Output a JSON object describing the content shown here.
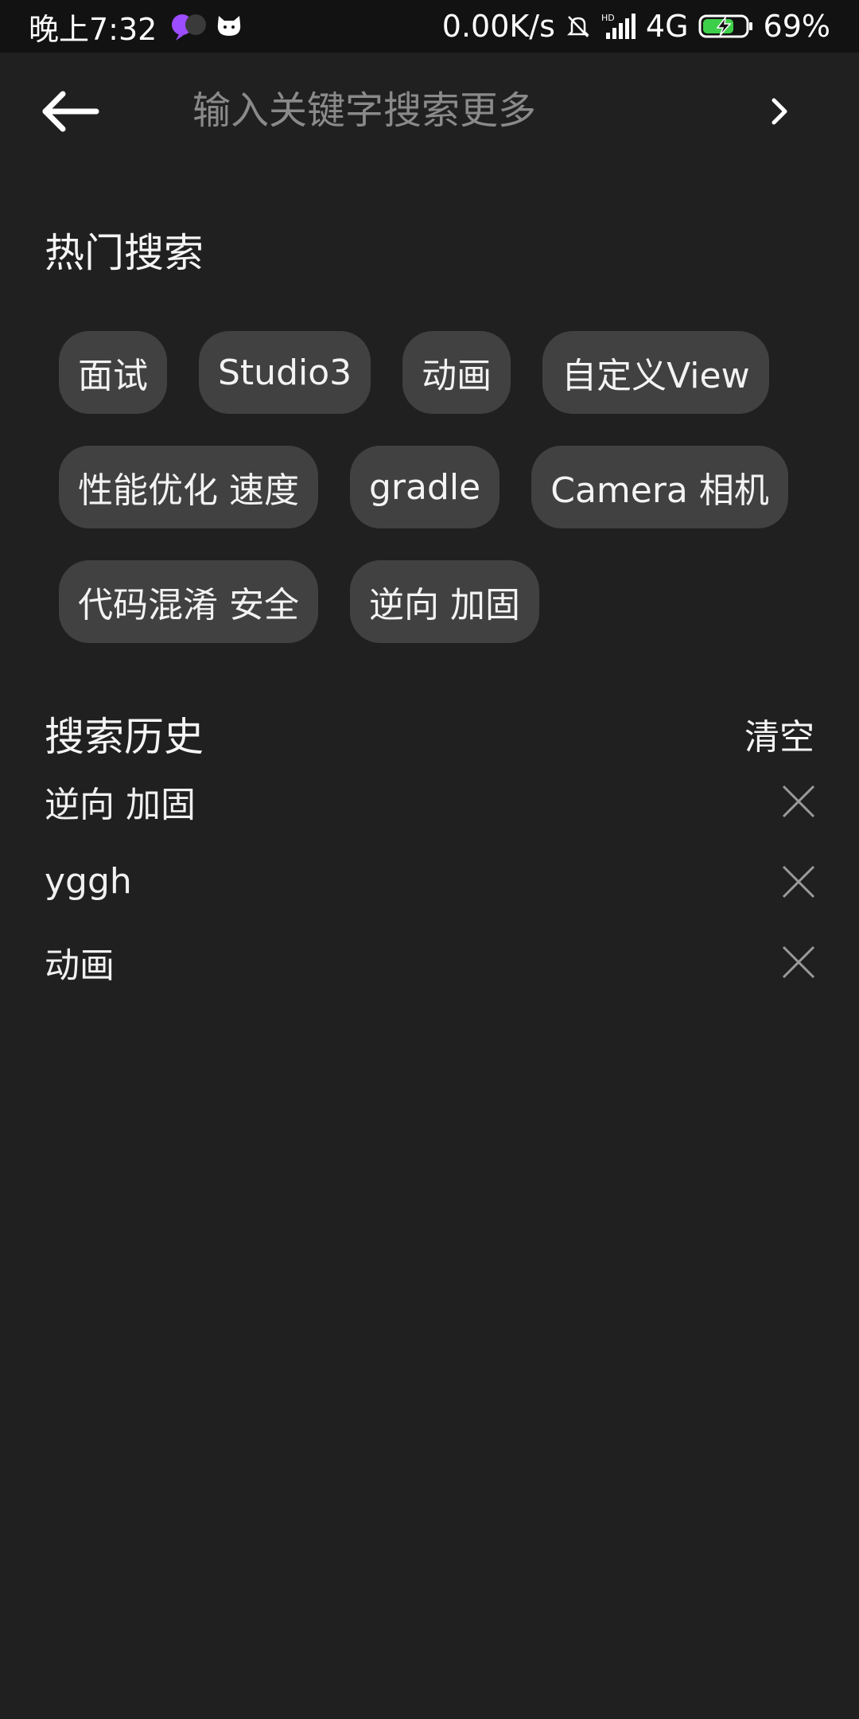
{
  "status_bar": {
    "time": "晚上7:32",
    "net_speed": "0.00K/s",
    "network": "4G",
    "battery": "69%",
    "icons": [
      "meng-hi-app-icon",
      "cat-app-icon",
      "mute-bell-icon",
      "hd-signal-icon",
      "charging-battery-icon"
    ],
    "battery_fill_color": "#3ecf4a"
  },
  "search": {
    "placeholder": "输入关键字搜索更多",
    "value": ""
  },
  "hot": {
    "title": "热门搜索",
    "tags": [
      "面试",
      "Studio3",
      "动画",
      "自定义View",
      "性能优化 速度",
      "gradle",
      "Camera 相机",
      "代码混淆 安全",
      "逆向 加固"
    ]
  },
  "history": {
    "title": "搜索历史",
    "clear_label": "清空",
    "items": [
      "逆向 加固",
      "yggh",
      "动画"
    ]
  },
  "colors": {
    "background": "#202020",
    "status_bar": "#121212",
    "tag_bg": "#414141",
    "text": "#f2f2f2",
    "placeholder": "#8a8a8a"
  }
}
